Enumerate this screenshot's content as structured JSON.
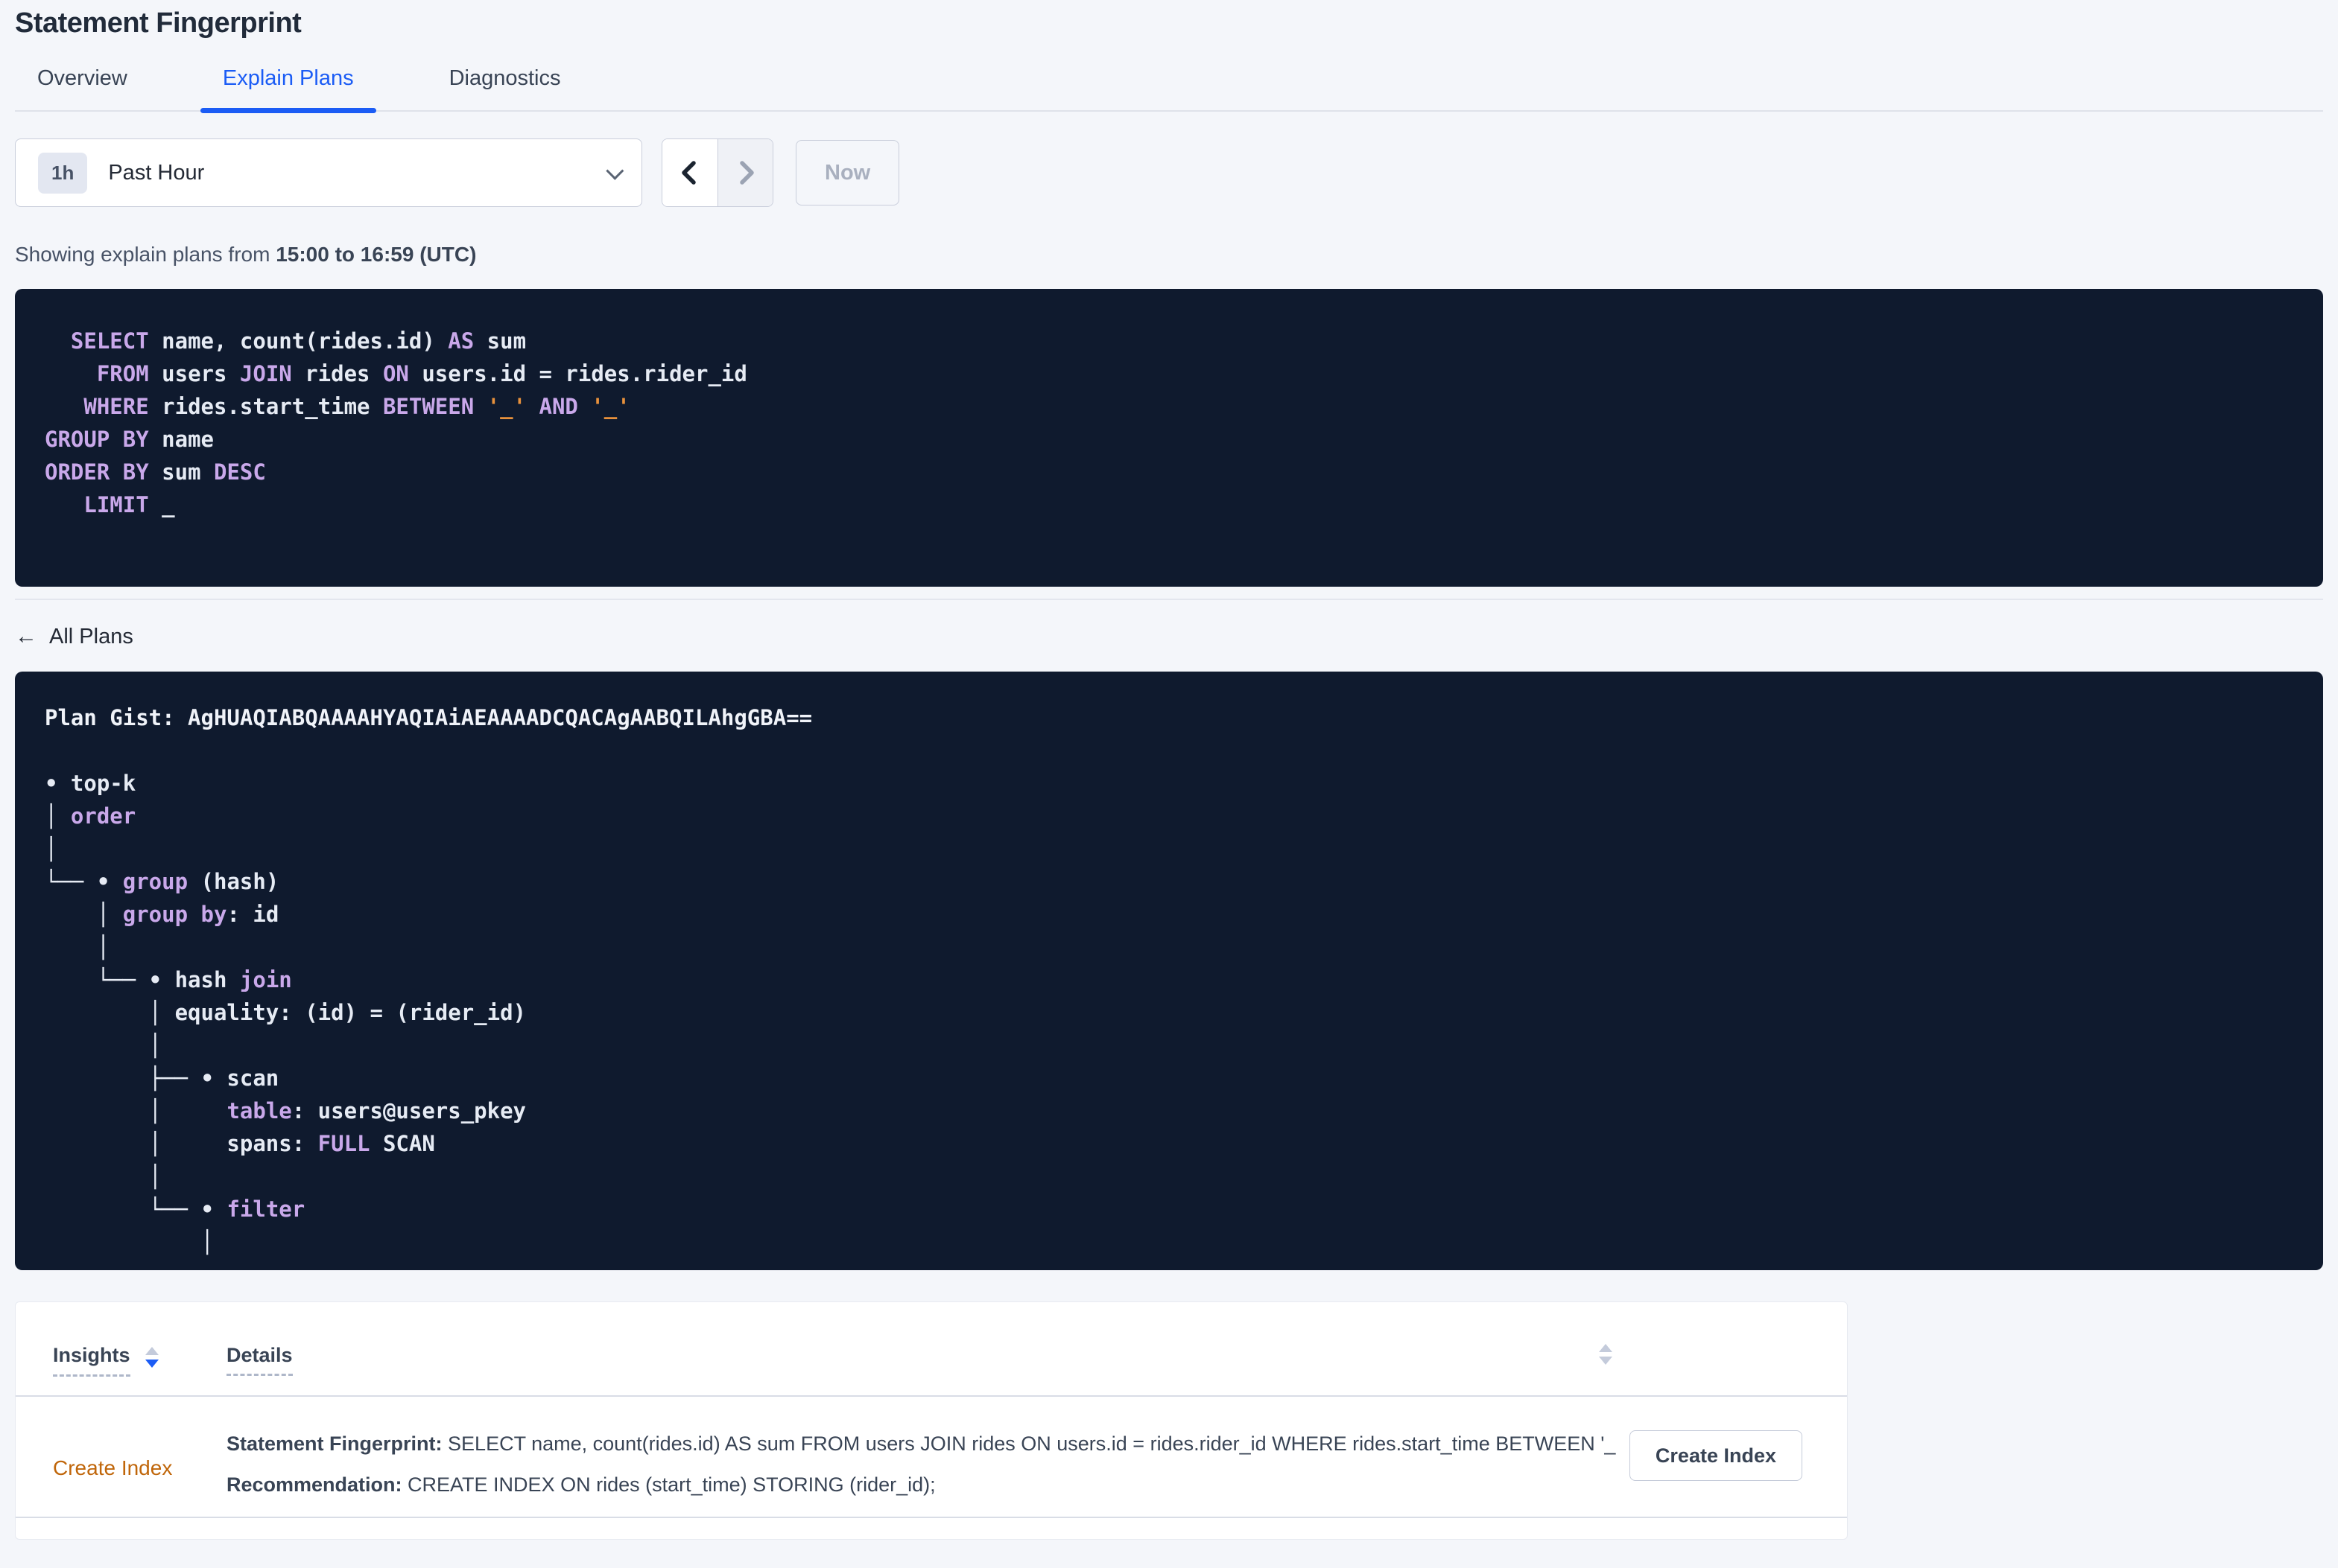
{
  "page": {
    "title": "Statement Fingerprint"
  },
  "tabs": [
    {
      "label": "Overview",
      "active": false
    },
    {
      "label": "Explain Plans",
      "active": true
    },
    {
      "label": "Diagnostics",
      "active": false
    }
  ],
  "time_picker": {
    "badge": "1h",
    "label": "Past Hour",
    "now_label": "Now",
    "prev_icon": "chevron-left",
    "next_icon": "chevron-right"
  },
  "range_summary": {
    "prefix": "Showing explain plans from ",
    "bold": "15:00 to 16:59 (UTC)"
  },
  "sql_lines": [
    [
      {
        "c": "kw",
        "t": "  SELECT"
      },
      {
        "c": "id",
        "t": " name, count(rides.id) "
      },
      {
        "c": "kw",
        "t": "AS"
      },
      {
        "c": "id",
        "t": " sum"
      }
    ],
    [
      {
        "c": "kw",
        "t": "    FROM"
      },
      {
        "c": "id",
        "t": " users "
      },
      {
        "c": "kw",
        "t": "JOIN"
      },
      {
        "c": "id",
        "t": " rides "
      },
      {
        "c": "kw",
        "t": "ON"
      },
      {
        "c": "id",
        "t": " users.id = rides.rider_id"
      }
    ],
    [
      {
        "c": "kw",
        "t": "   WHERE"
      },
      {
        "c": "id",
        "t": " rides.start_time "
      },
      {
        "c": "kw",
        "t": "BETWEEN"
      },
      {
        "c": "str",
        "t": " '_'"
      },
      {
        "c": "kw",
        "t": " AND"
      },
      {
        "c": "str",
        "t": " '_'"
      }
    ],
    [
      {
        "c": "kw",
        "t": "GROUP BY"
      },
      {
        "c": "id",
        "t": " name"
      }
    ],
    [
      {
        "c": "kw",
        "t": "ORDER BY"
      },
      {
        "c": "id",
        "t": " sum "
      },
      {
        "c": "kw",
        "t": "DESC"
      }
    ],
    [
      {
        "c": "kw",
        "t": "   LIMIT"
      },
      {
        "c": "id",
        "t": " _"
      }
    ]
  ],
  "all_plans_label": "All Plans",
  "plan_gist": "AgHUAQIABQAAAAHYAQIAiAEAAAADCQACAgAABQILAhgGBA==",
  "plan_lines": [
    [
      {
        "c": "wb",
        "t": "Plan Gist: AgHUAQIABQAAAAHYAQIAiAEAAAADCQACAgAABQILAhgGBA=="
      }
    ],
    [
      {
        "c": "w",
        "t": ""
      }
    ],
    [
      {
        "c": "w",
        "t": "• top-k"
      }
    ],
    [
      {
        "c": "w",
        "t": "│ "
      },
      {
        "c": "kw",
        "t": "order"
      }
    ],
    [
      {
        "c": "w",
        "t": "│"
      }
    ],
    [
      {
        "c": "w",
        "t": "└── • "
      },
      {
        "c": "kw",
        "t": "group"
      },
      {
        "c": "w",
        "t": " (hash)"
      }
    ],
    [
      {
        "c": "w",
        "t": "    │ "
      },
      {
        "c": "kw",
        "t": "group by"
      },
      {
        "c": "w",
        "t": ": id"
      }
    ],
    [
      {
        "c": "w",
        "t": "    │"
      }
    ],
    [
      {
        "c": "w",
        "t": "    └── • hash "
      },
      {
        "c": "kw",
        "t": "join"
      }
    ],
    [
      {
        "c": "w",
        "t": "        │ equality: (id) = (rider_id)"
      }
    ],
    [
      {
        "c": "w",
        "t": "        │"
      }
    ],
    [
      {
        "c": "w",
        "t": "        ├── • scan"
      }
    ],
    [
      {
        "c": "w",
        "t": "        │     "
      },
      {
        "c": "kw",
        "t": "table"
      },
      {
        "c": "w",
        "t": ": users@users_pkey"
      }
    ],
    [
      {
        "c": "w",
        "t": "        │     spans: "
      },
      {
        "c": "kw",
        "t": "FULL"
      },
      {
        "c": "w",
        "t": " SCAN"
      }
    ],
    [
      {
        "c": "w",
        "t": "        │"
      }
    ],
    [
      {
        "c": "w",
        "t": "        └── • "
      },
      {
        "c": "kw",
        "t": "filter"
      }
    ],
    [
      {
        "c": "w",
        "t": "            │"
      }
    ]
  ],
  "insights_table": {
    "columns": [
      {
        "label": "Insights",
        "sorted": "desc"
      },
      {
        "label": "Details",
        "sorted": "none"
      }
    ],
    "rows": [
      {
        "insight": "Create Index",
        "fingerprint_label": "Statement Fingerprint:",
        "fingerprint_text": "SELECT name, count(rides.id) AS sum FROM users JOIN rides ON users.id = rides.rider_id WHERE rides.start_time BETWEEN '_…",
        "recommendation_label": "Recommendation:",
        "recommendation_text": "CREATE INDEX ON rides (start_time) STORING (rider_id);",
        "action_label": "Create Index"
      }
    ]
  },
  "colors": {
    "accent_blue": "#1B5CF5",
    "code_background": "#0F1A2E",
    "code_keyword": "#C9A8EA",
    "code_identifier": "#E6EBF4",
    "code_literal": "#E8913C",
    "insight_link_orange": "#C0660A",
    "page_background": "#F4F6FA",
    "text_slate": "#394455"
  }
}
